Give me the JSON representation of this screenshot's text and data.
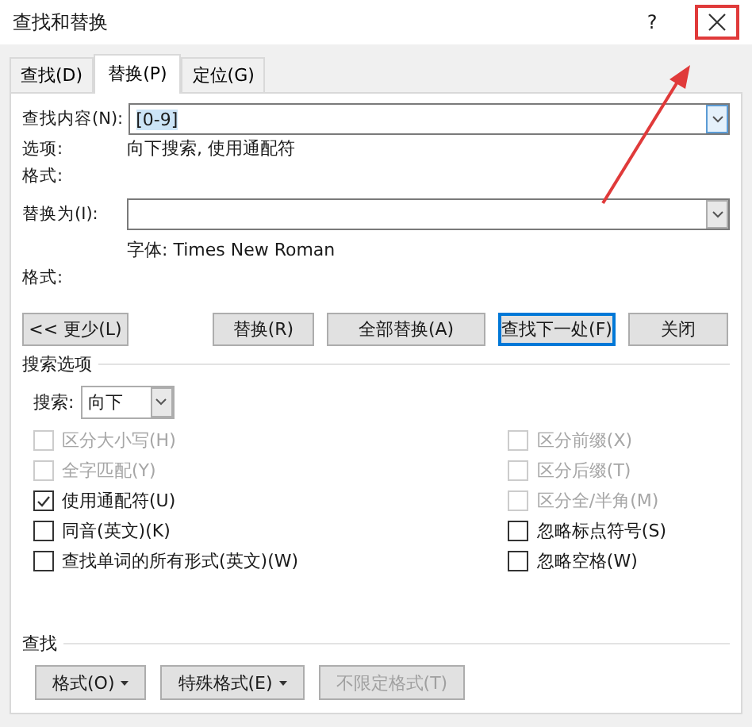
{
  "window": {
    "title": "查找和替换",
    "help": "?",
    "close_highlighted": true
  },
  "tabs": [
    {
      "label": "查找(D)",
      "selected": false
    },
    {
      "label": "替换(P)",
      "selected": true
    },
    {
      "label": "定位(G)",
      "selected": false
    }
  ],
  "find": {
    "label": "查找内容(N):",
    "value": "[0-9]",
    "value_selected": true,
    "options_label": "选项:",
    "options_value": "向下搜索, 使用通配符",
    "format_label": "格式:"
  },
  "replace": {
    "label": "替换为(I):",
    "format_label": "格式:",
    "format_value": "字体: Times New Roman"
  },
  "buttons": [
    {
      "label": "<< 更少(L)",
      "default": false
    },
    {
      "label": "替换(R)",
      "default": false
    },
    {
      "label": "全部替换(A)",
      "default": false
    },
    {
      "label": "查找下一处(F)",
      "default": true
    },
    {
      "label": "关闭",
      "default": false
    }
  ],
  "search_options": {
    "title": "搜索选项",
    "direction_label": "搜索:",
    "direction_value": "向下",
    "left": [
      {
        "label": "区分大小写(H)",
        "checked": false,
        "disabled": true
      },
      {
        "label": "全字匹配(Y)",
        "checked": false,
        "disabled": true
      },
      {
        "label": "使用通配符(U)",
        "checked": true,
        "disabled": false
      },
      {
        "label": "同音(英文)(K)",
        "checked": false,
        "disabled": false
      },
      {
        "label": "查找单词的所有形式(英文)(W)",
        "checked": false,
        "disabled": false
      }
    ],
    "right": [
      {
        "label": "区分前缀(X)",
        "checked": false,
        "disabled": true
      },
      {
        "label": "区分后缀(T)",
        "checked": false,
        "disabled": true
      },
      {
        "label": "区分全/半角(M)",
        "checked": false,
        "disabled": true
      },
      {
        "label": "忽略标点符号(S)",
        "checked": false,
        "disabled": false
      },
      {
        "label": "忽略空格(W)",
        "checked": false,
        "disabled": false
      }
    ]
  },
  "find_section": {
    "title": "查找",
    "buttons": [
      {
        "label": "格式(O)",
        "dropdown": true,
        "disabled": false
      },
      {
        "label": "特殊格式(E)",
        "dropdown": true,
        "disabled": false
      },
      {
        "label": "不限定格式(T)",
        "dropdown": false,
        "disabled": true
      }
    ]
  }
}
